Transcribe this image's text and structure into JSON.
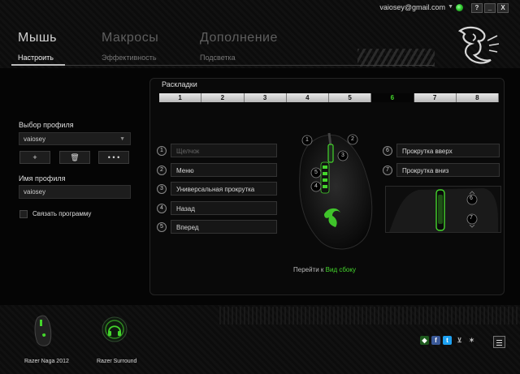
{
  "titlebar": {
    "account": "vaiosey@gmail.com",
    "help": "?",
    "minimize": "_",
    "close": "X"
  },
  "nav": {
    "tabs": [
      {
        "label": "Мышь",
        "sub": "Настроить"
      },
      {
        "label": "Макросы",
        "sub": "Эффективность"
      },
      {
        "label": "Дополнение",
        "sub": "Подсветка"
      }
    ]
  },
  "sidebar": {
    "profile_label": "Выбор профиля",
    "profile_value": "vaiosey",
    "add": "+",
    "delete": "🗑",
    "more": "• • •",
    "name_label": "Имя профиля",
    "name_value": "vaiosey",
    "link_program": "Связать программу"
  },
  "layouts": {
    "title": "Раскладки",
    "tabs": [
      "1",
      "2",
      "3",
      "4",
      "5",
      "6",
      "7",
      "8"
    ],
    "active_tab": "6",
    "left_buttons": [
      {
        "num": "1",
        "label": "Щелчок"
      },
      {
        "num": "2",
        "label": "Меню"
      },
      {
        "num": "3",
        "label": "Универсальная прокрутка"
      },
      {
        "num": "4",
        "label": "Назад"
      },
      {
        "num": "5",
        "label": "Вперед"
      }
    ],
    "right_buttons": [
      {
        "num": "6",
        "label": "Прокрутка вверх"
      },
      {
        "num": "7",
        "label": "Прокрутка вниз"
      }
    ],
    "goto_prefix": "Перейти к",
    "goto_link": "Вид сбоку"
  },
  "devices": [
    {
      "name": "Razer Naga 2012"
    },
    {
      "name": "Razer Surround"
    }
  ],
  "social": [
    "razer-icon",
    "facebook-icon",
    "twitter-icon",
    "cart-icon",
    "razer-logo-icon"
  ],
  "colors": {
    "accent": "#44d62c"
  }
}
